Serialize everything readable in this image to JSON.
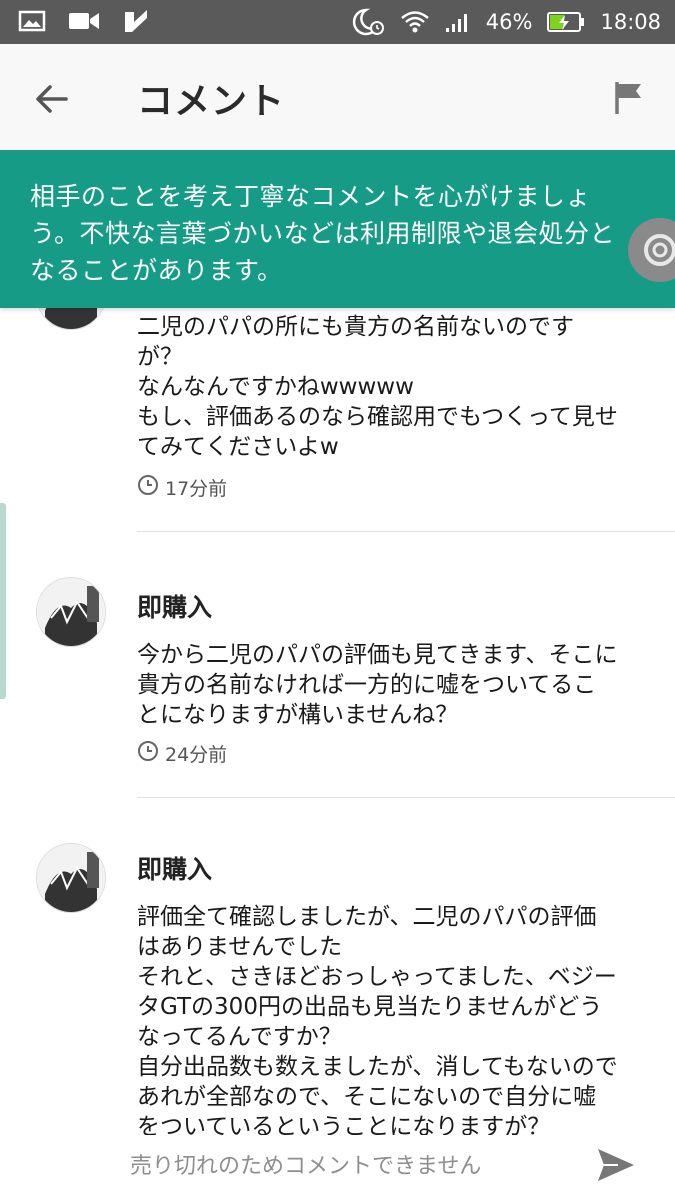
{
  "status_bar": {
    "battery": "46%",
    "time": "18:08",
    "icons": [
      "image-icon",
      "video-icon",
      "app-checkmark-icon",
      "moon-alarm-icon",
      "wifi-icon",
      "signal-icon",
      "battery-charging-icon"
    ]
  },
  "header": {
    "title": "コメント",
    "back_icon": "arrow-left-icon",
    "report_icon": "flag-icon"
  },
  "notice": {
    "lines": [
      "相手のことを考え丁寧なコメントを心がけましょ",
      "う。不快な言葉づかいなどは利用制限や退会処分と",
      "なることがあります。"
    ]
  },
  "comments": [
    {
      "username": "",
      "body": [
        "二児のパパの所にも貴方の名前ないのです",
        "が？",
        "なんなんですかねwwwww",
        "もし、評価あるのなら確認用でもつくって見せ",
        "てみてくださいよw"
      ],
      "time": "17分前"
    },
    {
      "username": "即購入",
      "body": [
        "今から二児のパパの評価も見てきます、そこに",
        "貴方の名前なければ一方的に嘘をついてるこ",
        "とになりますが構いませんね？"
      ],
      "time": "24分前"
    },
    {
      "username": "即購入",
      "body": [
        "評価全て確認しましたが、二児のパパの評価",
        "はありませんでした",
        "それと、さきほどおっしゃってました、ベジー",
        "タGTの300円の出品も見当たりませんがどう",
        "なってるんですか？",
        "自分出品数も数えましたが、消してもないので",
        "あれが全部なので、そこにないので自分に嘘",
        "をついているということになりますが？"
      ],
      "time": ""
    }
  ],
  "input": {
    "placeholder": "売り切れのためコメントできません",
    "send_icon": "send-icon"
  },
  "colors": {
    "status_bar": "#5a5a5a",
    "app_bar": "#f8f8f8",
    "notice_bg": "#159b86",
    "accent_battery": "#7ed321"
  }
}
